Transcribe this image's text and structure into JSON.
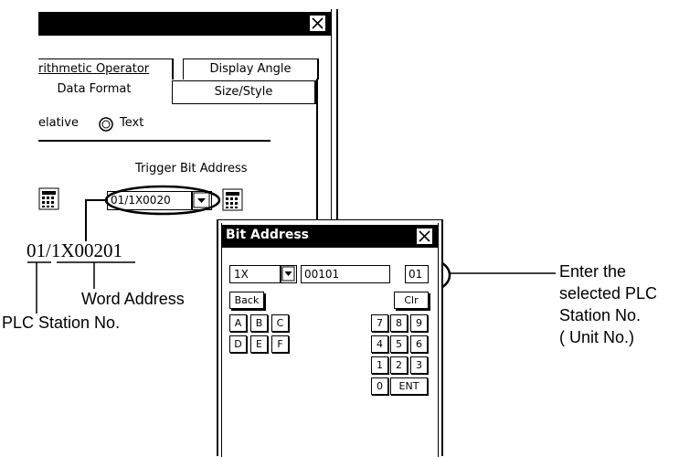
{
  "main_dialog": {
    "tabs": [
      {
        "label": "rithmetic Operator"
      },
      {
        "label": "Display Angle"
      },
      {
        "label": "Data Format"
      },
      {
        "label": "Size/Style"
      }
    ],
    "radio_relative_label": "elative",
    "radio_text_label": "Text",
    "trigger_bit_label": "Trigger Bit Address",
    "trigger_bit_value": "01/1X0020"
  },
  "bit_dialog": {
    "title": "Bit Address",
    "device_select": "1X",
    "address_value": "00101",
    "station_value": "01",
    "keys": {
      "back": "Back",
      "clr": "Clr",
      "a": "A",
      "b": "B",
      "c": "C",
      "d": "D",
      "e": "E",
      "f": "F",
      "n7": "7",
      "n8": "8",
      "n9": "9",
      "n4": "4",
      "n5": "5",
      "n6": "6",
      "n1": "1",
      "n2": "2",
      "n3": "3",
      "n0": "0",
      "ent": "ENT"
    }
  },
  "annotations": {
    "address_example": "01/1X00201",
    "word_address": "Word Address",
    "plc_station": "PLC Station No.",
    "enter_line1": "Enter the",
    "enter_line2": "selected PLC",
    "enter_line3": "Station No.",
    "enter_line4": "( Unit No.)"
  }
}
